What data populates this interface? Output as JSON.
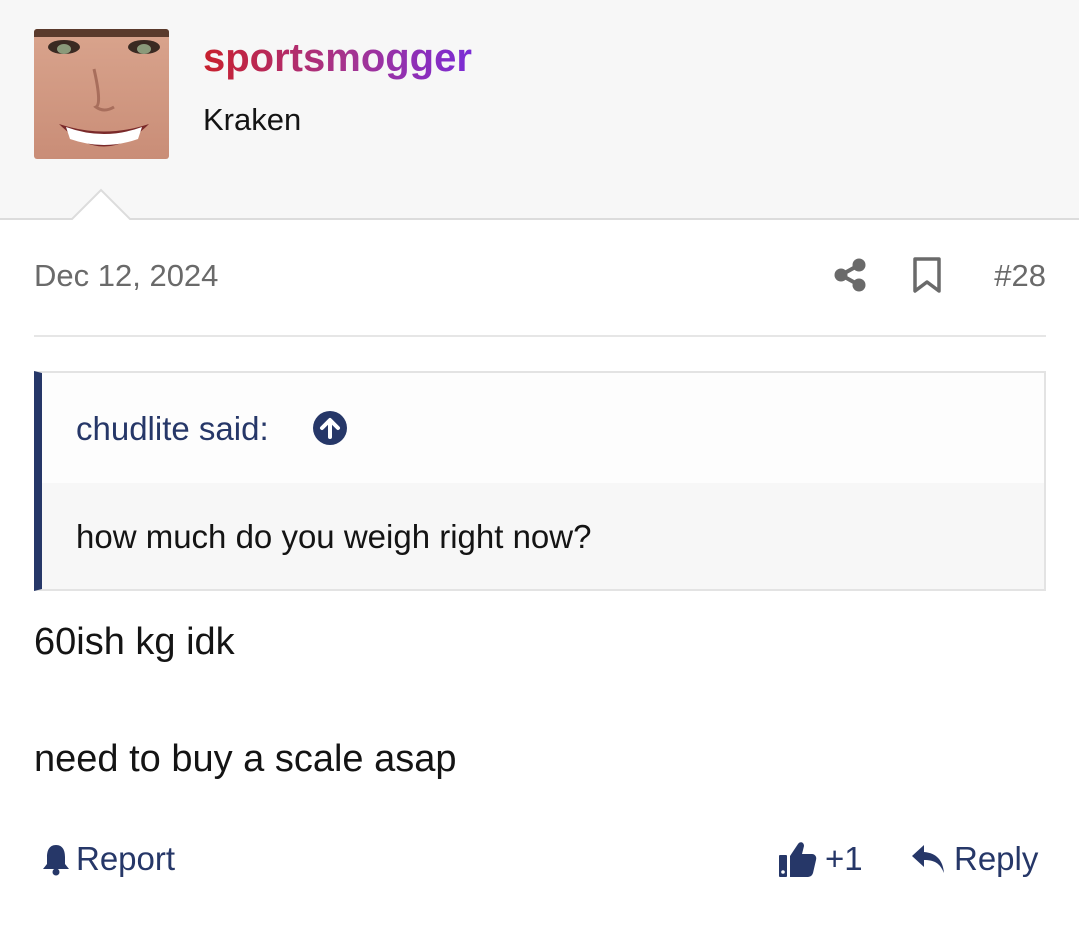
{
  "author": {
    "username": "sportsmogger",
    "title": "Kraken",
    "avatar_icon": "user-avatar-photo"
  },
  "post": {
    "date": "Dec 12, 2024",
    "number": "#28",
    "icons": {
      "share": "share-icon",
      "bookmark": "bookmark-icon"
    },
    "quote": {
      "author_line": "chudlite said:",
      "text": "how much do you weigh right now?",
      "jump_icon": "arrow-up-circle-icon"
    },
    "body_lines": [
      "60ish kg idk",
      "need to buy a scale asap"
    ]
  },
  "actions": {
    "report_label": "Report",
    "like_label": "+1",
    "reply_label": "Reply"
  },
  "colors": {
    "accent": "#263768",
    "username_gradient": [
      "#c8202c",
      "#a43492",
      "#7b2bd6"
    ],
    "header_bg": "#f7f7f7",
    "meta_text": "#6a6a6a"
  }
}
